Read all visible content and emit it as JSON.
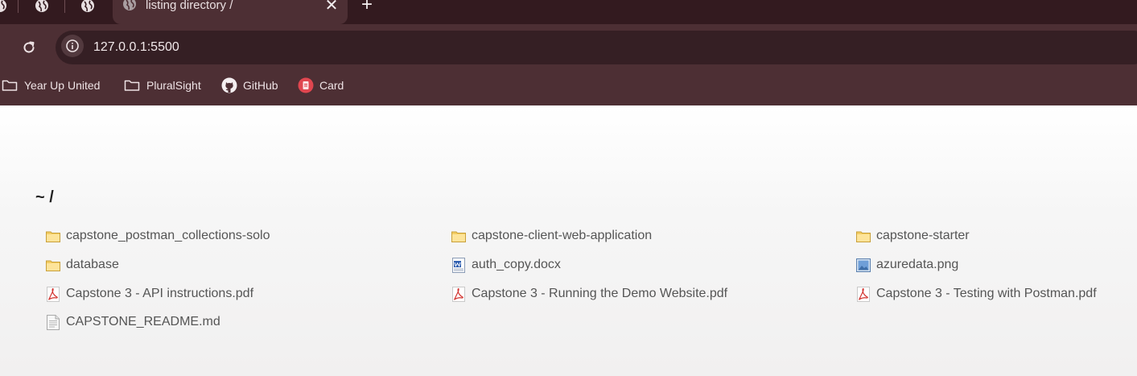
{
  "browser": {
    "active_tab": {
      "title": "listing directory /",
      "close_glyph": "✕"
    },
    "new_tab_glyph": "+",
    "address_bar": {
      "url": "127.0.0.1:5500"
    },
    "bookmarks": [
      {
        "label": "Year Up United",
        "icon": "folder-icon"
      },
      {
        "label": "PluralSight",
        "icon": "folder-icon"
      },
      {
        "label": "GitHub",
        "icon": "github-icon"
      },
      {
        "label": "Card",
        "icon": "card-icon"
      }
    ]
  },
  "page": {
    "heading": "~ /",
    "files": [
      {
        "name": "capstone_postman_collections-solo",
        "type": "folder"
      },
      {
        "name": "capstone-client-web-application",
        "type": "folder"
      },
      {
        "name": "capstone-starter",
        "type": "folder"
      },
      {
        "name": "database",
        "type": "folder"
      },
      {
        "name": "auth_copy.docx",
        "type": "docx"
      },
      {
        "name": "azuredata.png",
        "type": "image"
      },
      {
        "name": "Capstone 3 - API instructions.pdf",
        "type": "pdf"
      },
      {
        "name": "Capstone 3 - Running the Demo Website.pdf",
        "type": "pdf"
      },
      {
        "name": "Capstone 3 - Testing with Postman.pdf",
        "type": "pdf"
      },
      {
        "name": "CAPSTONE_README.md",
        "type": "text"
      }
    ]
  },
  "colors": {
    "tabstrip": "#331a1f",
    "toolbar": "#4d2f34",
    "omnibox": "#351f24",
    "page_text": "#555555"
  }
}
